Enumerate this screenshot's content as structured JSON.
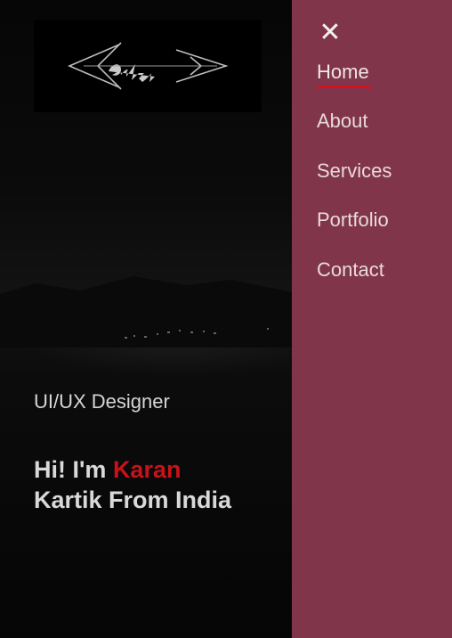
{
  "logo": {
    "alt": "Kartik"
  },
  "hero": {
    "subtitle": "UI/UX Designer",
    "greeting": "Hi! I'm",
    "first_name": "Karan",
    "tagline": "Kartik From India"
  },
  "menu": {
    "close_icon": "close-icon",
    "items": [
      {
        "label": "Home",
        "active": true
      },
      {
        "label": "About",
        "active": false
      },
      {
        "label": "Services",
        "active": false
      },
      {
        "label": "Portfolio",
        "active": false
      },
      {
        "label": "Contact",
        "active": false
      }
    ]
  },
  "colors": {
    "menu_bg": "#81354b",
    "accent": "#c8121a",
    "underline": "#d0131f"
  }
}
